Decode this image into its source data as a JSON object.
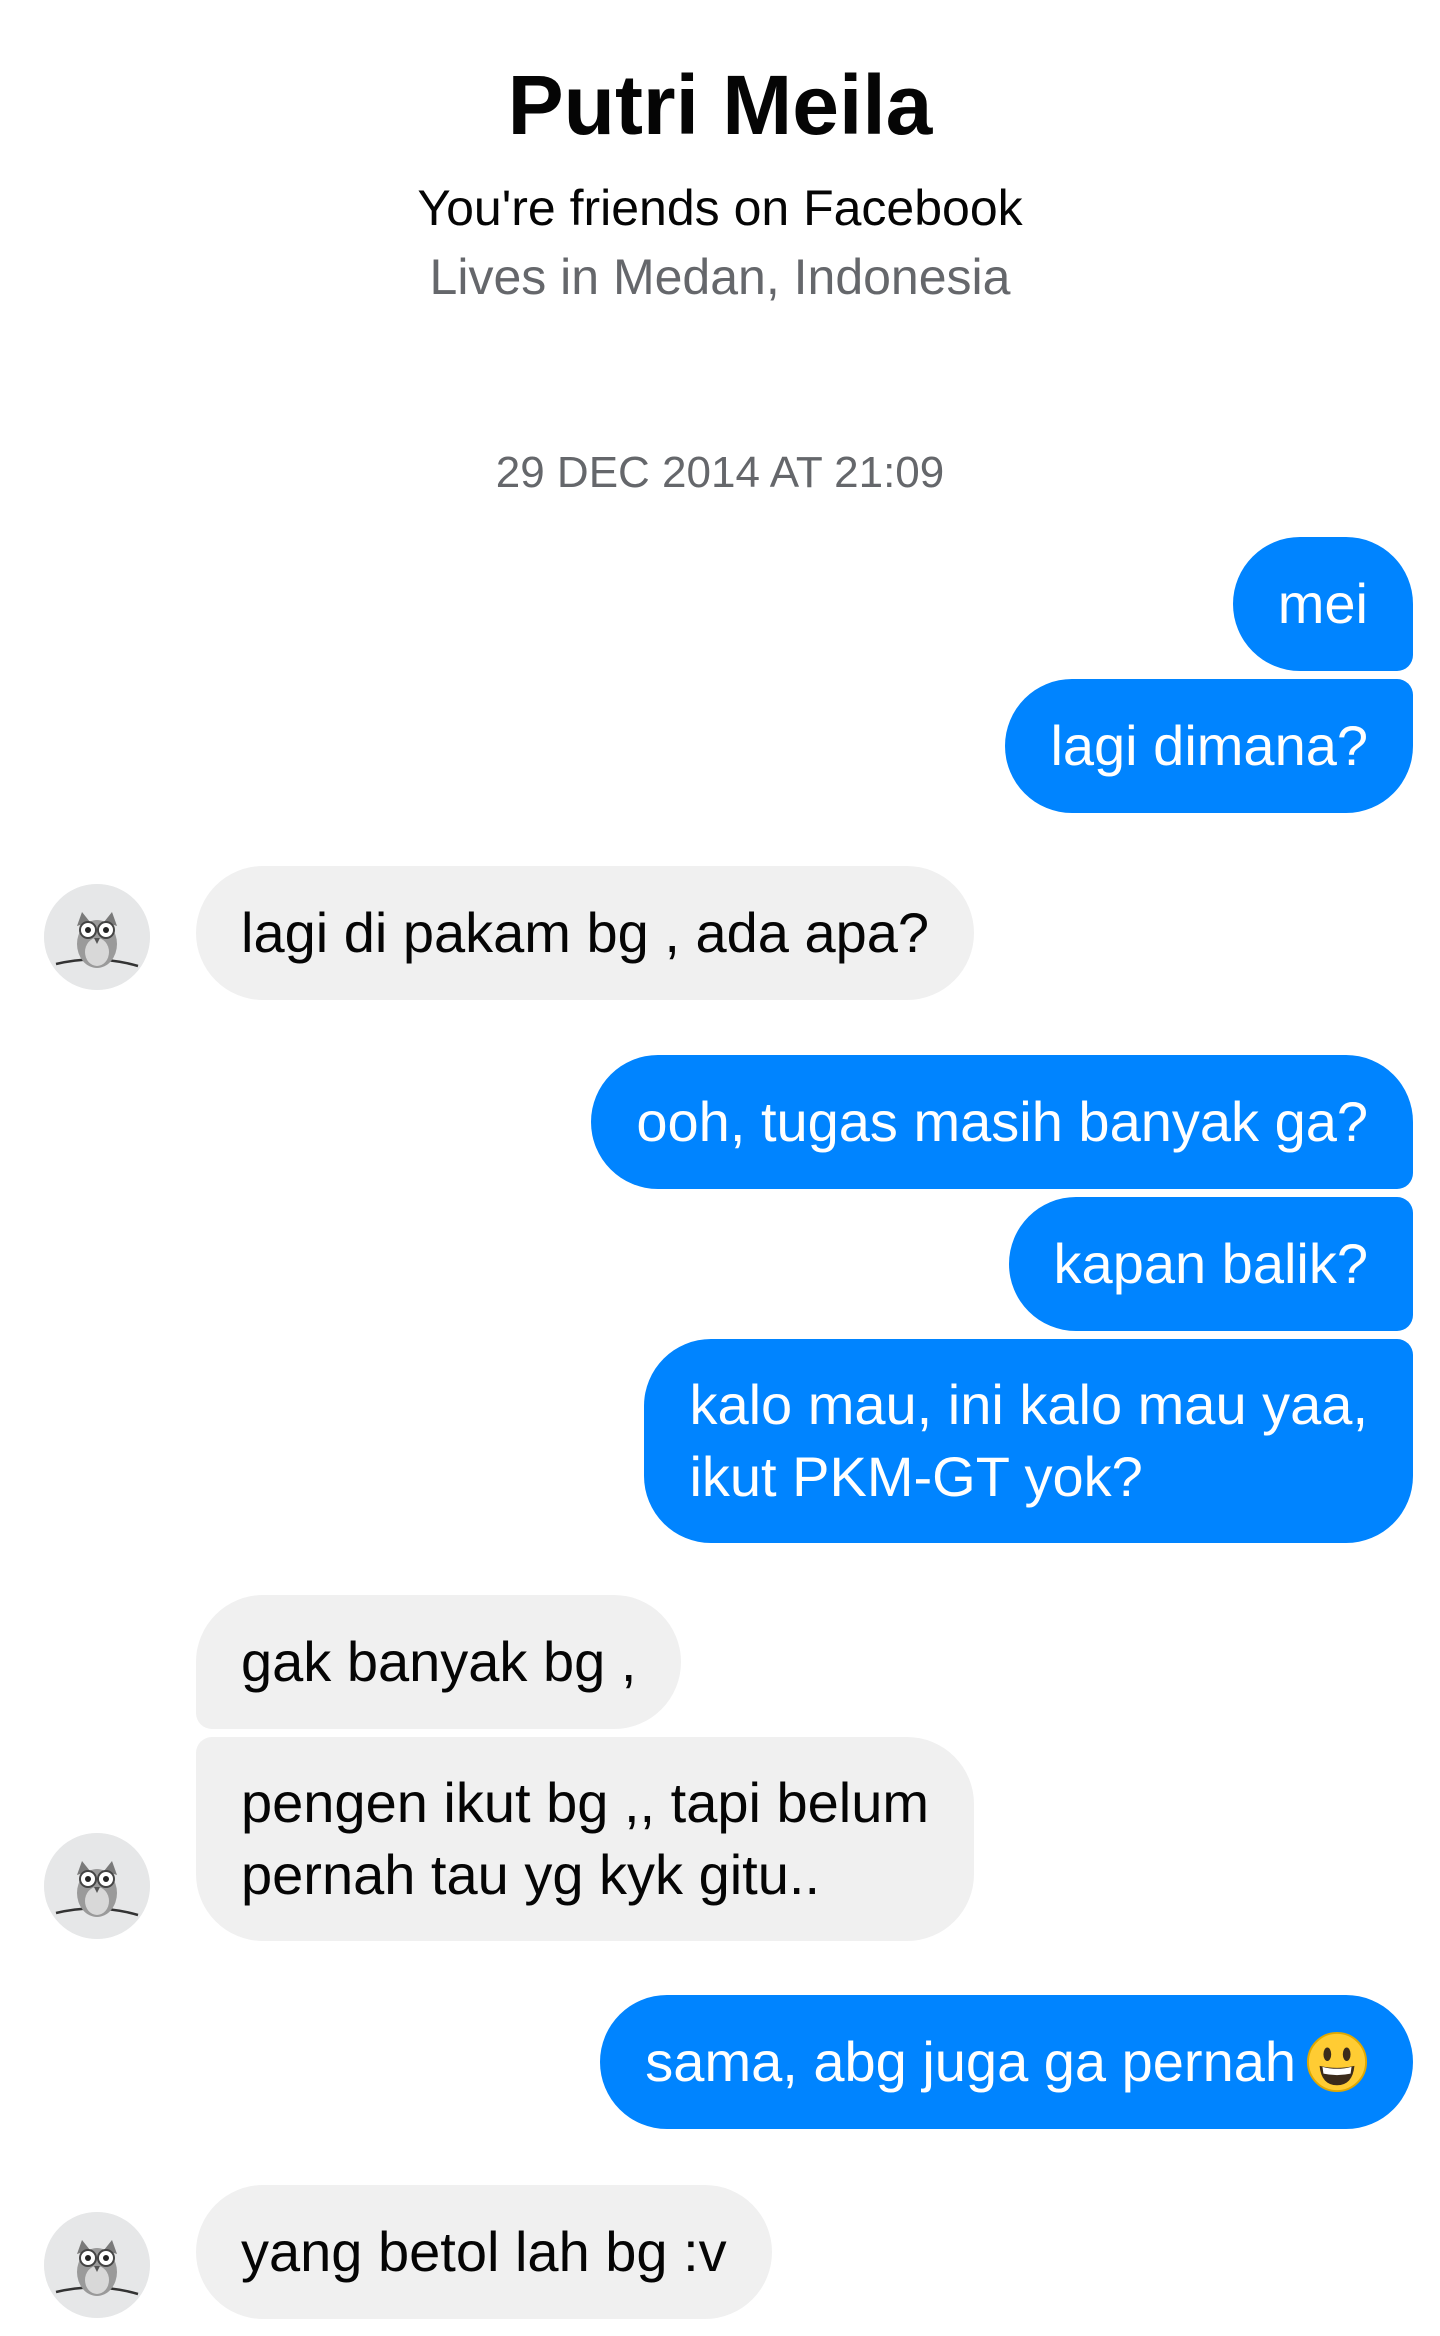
{
  "header": {
    "name": "Putri Meila",
    "friends_text": "You're friends on Facebook",
    "location_text": "Lives in Medan, Indonesia"
  },
  "timestamp": "29 DEC 2014 AT 21:09",
  "messages": [
    {
      "direction": "outgoing",
      "text": "mei"
    },
    {
      "direction": "outgoing",
      "text": "lagi dimana?"
    },
    {
      "direction": "incoming",
      "text": "lagi di pakam bg , ada apa?"
    },
    {
      "direction": "outgoing",
      "text": "ooh, tugas masih banyak ga?"
    },
    {
      "direction": "outgoing",
      "text": "kapan balik?"
    },
    {
      "direction": "outgoing",
      "text": "kalo mau, ini kalo mau yaa,\nikut PKM-GT yok?"
    },
    {
      "direction": "incoming",
      "text": "gak banyak bg ,"
    },
    {
      "direction": "incoming",
      "text": "pengen ikut bg ,, tapi belum\npernah tau yg kyk gitu.."
    },
    {
      "direction": "outgoing",
      "text": "sama, abg juga ga pernah",
      "emoji": "grinning-face-emoji"
    },
    {
      "direction": "incoming",
      "text": "yang betol lah bg :v"
    }
  ],
  "colors": {
    "outgoing_bubble": "#0084ff",
    "incoming_bubble": "#f0f0f0",
    "secondary_text": "#65676b"
  },
  "icons": {
    "avatar": "owl-avatar-icon"
  }
}
